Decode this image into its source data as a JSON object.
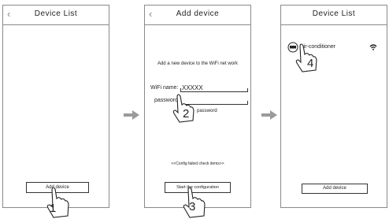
{
  "screen1": {
    "back_icon": "‹",
    "title": "Device  List",
    "button": "Add device",
    "step": "1"
  },
  "screen2": {
    "back_icon": "‹",
    "title": "Add device",
    "instruction": "Add a new device to the WiFi net work",
    "wifi_label": "WiFi  name:",
    "wifi_value": "XXXXX",
    "password_label": "password:",
    "show_password": "password",
    "config_failed": "<<Config failed check items>>",
    "button": "Start the configuration",
    "step2": "2",
    "step3": "3"
  },
  "screen3": {
    "title": "Device  List",
    "device_name": "Air-conditioner",
    "button": "Add device",
    "step": "4"
  },
  "arrow_color": "#9a9a9a"
}
